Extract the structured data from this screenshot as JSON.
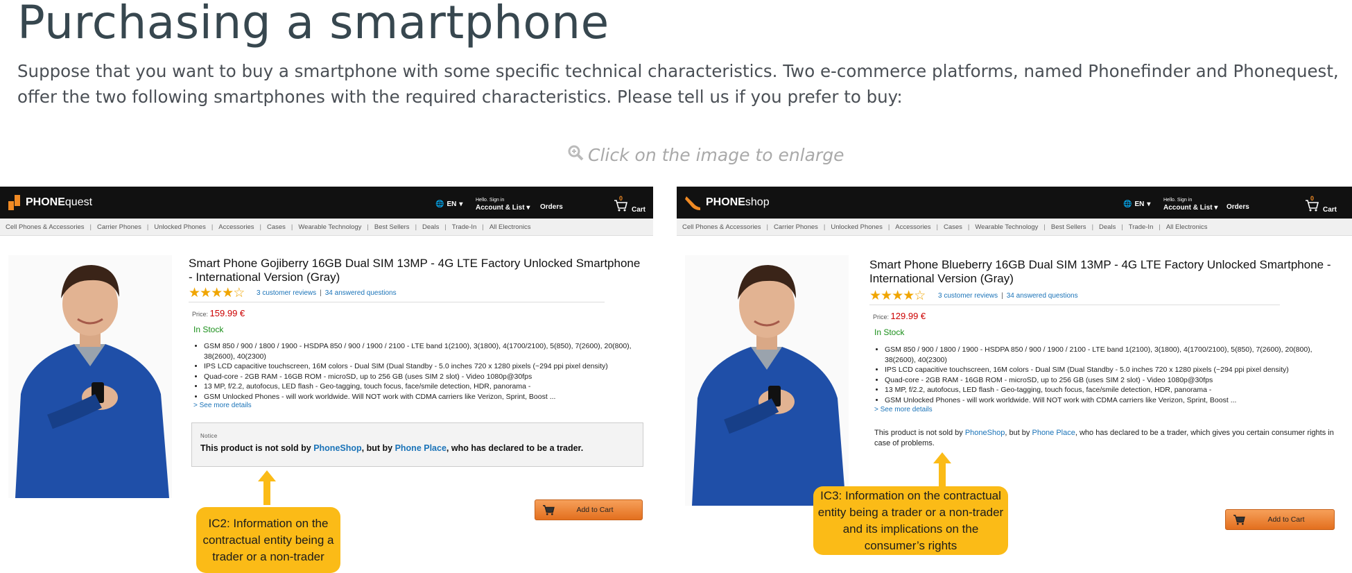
{
  "page": {
    "title": "Purchasing a smartphone",
    "intro": "Suppose that you want to buy a smartphone with some specific technical characteristics. Two e-commerce platforms, named Phonefinder and Phonequest, offer the two following smartphones with the required characteristics. Please tell us if you prefer to buy:",
    "enlarge_hint": "Click on the image to enlarge"
  },
  "topbar": {
    "lang": "EN",
    "greeting": "Hello. Sign in",
    "account": "Account & List",
    "orders": "Orders",
    "cart": "Cart",
    "cart_count": "0"
  },
  "categories": [
    "Cell Phones & Accessories",
    "Carrier Phones",
    "Unlocked Phones",
    "Accessories",
    "Cases",
    "Wearable Technology",
    "Best Sellers",
    "Deals",
    "Trade-In",
    "All Electronics"
  ],
  "left": {
    "brand_bold": "PHONE",
    "brand_light": "quest",
    "title": "Smart Phone Gojiberry 16GB Dual SIM 13MP - 4G LTE Factory Unlocked Smartphone - International Version (Gray)",
    "rating": 4,
    "reviews": "3 customer reviews",
    "questions": "34 answered questions",
    "price_label": "Price:",
    "price": "159.99 €",
    "stock": "In Stock",
    "bullets": [
      "GSM 850 / 900 / 1800 / 1900 - HSDPA 850 / 900 / 1900 / 2100 - LTE band 1(2100), 3(1800), 4(1700/2100), 5(850), 7(2600), 20(800), 38(2600), 40(2300)",
      "IPS LCD capacitive touchscreen, 16M colors - Dual SIM (Dual Standby - 5.0 inches 720 x 1280 pixels (~294 ppi pixel density)",
      "Quad-core - 2GB RAM - 16GB ROM - microSD, up to 256 GB (uses SIM 2 slot) - Video 1080p@30fps",
      "13 MP, f/2.2, autofocus, LED flash - Geo-tagging, touch focus, face/smile detection, HDR, panorama -",
      "GSM Unlocked Phones - will work worldwide. Will NOT work with CDMA carriers like Verizon, Sprint, Boost ..."
    ],
    "see_more": "> See more details",
    "notice_head": "Notice",
    "notice_pre": "This product is not sold by ",
    "notice_seller": "PhoneShop",
    "notice_mid": ", but by ",
    "notice_trader": "Phone Place",
    "notice_post": ", who has declared to be a trader.",
    "add_to_cart": "Add to Cart",
    "callout": "IC2: Information  on the contractual entity being a trader or a non-trader"
  },
  "right": {
    "brand_bold": "PHONE",
    "brand_light": "shop",
    "title": "Smart Phone Blueberry 16GB Dual SIM 13MP - 4G LTE Factory Unlocked Smartphone - International Version (Gray)",
    "rating": 4,
    "reviews": "3 customer reviews",
    "questions": "34 answered questions",
    "price_label": "Price:",
    "price": "129.99 €",
    "stock": "In Stock",
    "bullets": [
      "GSM 850 / 900 / 1800 / 1900 - HSDPA 850 / 900 / 1900 / 2100 - LTE band 1(2100), 3(1800), 4(1700/2100), 5(850), 7(2600), 20(800), 38(2600), 40(2300)",
      "IPS LCD capacitive touchscreen, 16M colors - Dual SIM (Dual Standby - 5.0 inches 720 x 1280 pixels (~294 ppi pixel density)",
      "Quad-core - 2GB RAM - 16GB ROM - microSD, up to 256 GB (uses SIM 2 slot) - Video 1080p@30fps",
      "13 MP, f/2.2, autofocus, LED flash - Geo-tagging, touch focus, face/smile detection, HDR, panorama -",
      "GSM Unlocked Phones - will work worldwide. Will NOT work with CDMA carriers like Verizon, Sprint, Boost ..."
    ],
    "see_more": "> See more details",
    "notice_pre": "This product is not sold by ",
    "notice_seller": "PhoneShop",
    "notice_mid": ", but by ",
    "notice_trader": "Phone Place",
    "notice_post": ", who has declared to be a trader, which gives you certain consumer rights in case of problems.",
    "add_to_cart": "Add to Cart",
    "callout": "IC3: Information  on the contractual entity being a  trader or a non-trader and its implications on the consumer’s rights"
  },
  "colors": {
    "accent_orange": "#f08a24",
    "callout_yellow": "#fbbb17",
    "price_red": "#cc0000",
    "link_blue": "#1a73b8",
    "stock_green": "#1a8f1a"
  }
}
